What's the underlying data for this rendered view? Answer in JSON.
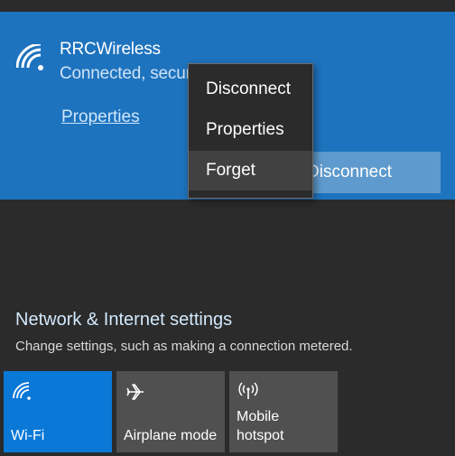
{
  "network": {
    "name": "RRCWireless",
    "status": "Connected, secured",
    "properties_link": "Properties",
    "disconnect_button": "Disconnect",
    "icon": "wifi-icon",
    "accent_color": "#1e73be"
  },
  "context_menu": {
    "items": [
      {
        "label": "Disconnect"
      },
      {
        "label": "Properties"
      },
      {
        "label": "Forget"
      }
    ],
    "highlighted": "Forget"
  },
  "settings_section": {
    "title": "Network & Internet settings",
    "subtitle": "Change settings, such as making a connection metered."
  },
  "quick_actions": [
    {
      "label": "Wi-Fi",
      "icon": "wifi-icon",
      "active": true
    },
    {
      "label": "Airplane mode",
      "icon": "airplane-icon",
      "active": false
    },
    {
      "label_line1": "Mobile",
      "label_line2": "hotspot",
      "icon": "hotspot-icon",
      "active": false
    }
  ]
}
